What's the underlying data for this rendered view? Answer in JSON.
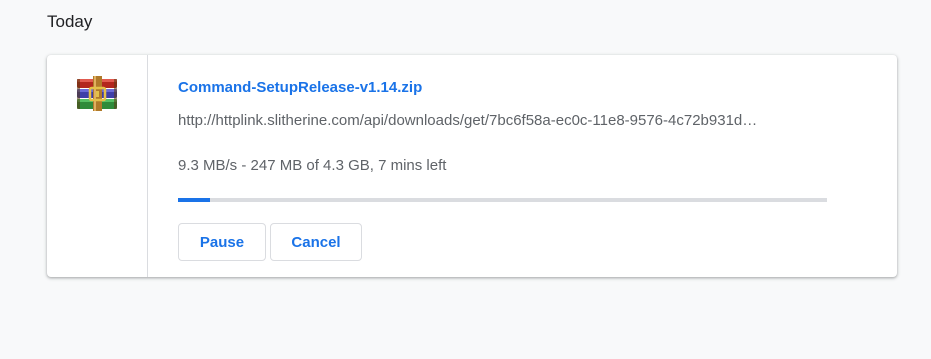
{
  "section": {
    "title": "Today"
  },
  "download": {
    "file_name": "Command-SetupRelease-v1.14.zip",
    "url": "http://httplink.slitherine.com/api/downloads/get/7bc6f58a-ec0c-11e8-9576-4c72b931d…",
    "status": "9.3 MB/s - 247 MB of 4.3 GB, 7 mins left",
    "progress_percent": 5,
    "icon": "winrar-archive-icon",
    "buttons": {
      "pause_label": "Pause",
      "cancel_label": "Cancel"
    }
  },
  "colors": {
    "accent": "#1a73e8",
    "track": "#dadce0",
    "background": "#f8f9fa"
  }
}
